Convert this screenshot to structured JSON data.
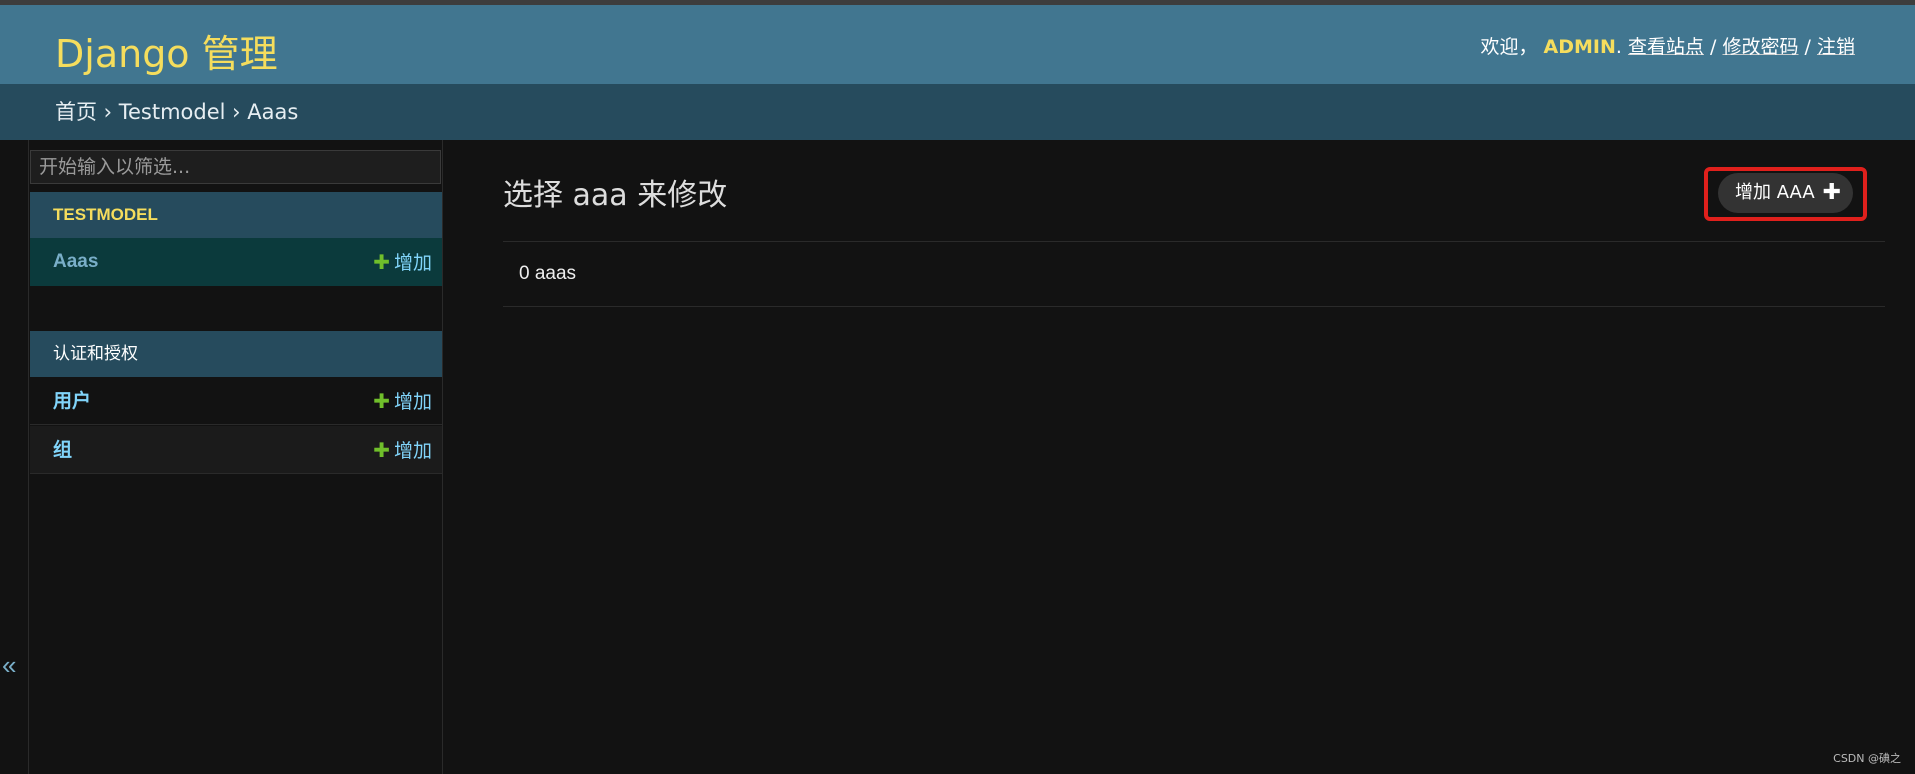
{
  "header": {
    "brand": "Django 管理",
    "welcome": "欢迎，",
    "username": "ADMIN",
    "view_site": "查看站点",
    "change_password": "修改密码",
    "logout": "注销",
    "separator": " / "
  },
  "breadcrumbs": {
    "home": "首页",
    "app": "Testmodel",
    "model": "Aaas",
    "separator": " › "
  },
  "sidebar": {
    "filter_placeholder": "开始输入以筛选...",
    "toggle_icon": "«",
    "modules": [
      {
        "caption": "TESTMODEL",
        "models": [
          {
            "name": "Aaas",
            "add_label": "增加"
          }
        ]
      },
      {
        "caption": "认证和授权",
        "models": [
          {
            "name": "用户",
            "add_label": "增加"
          },
          {
            "name": "组",
            "add_label": "增加"
          }
        ]
      }
    ]
  },
  "content": {
    "title": "选择 aaa 来修改",
    "add_button": "增加 AAA",
    "result_count": "0 aaas"
  },
  "watermark": "CSDN @碘之",
  "colors": {
    "header_bg": "#417690",
    "brand": "#f5dd5d",
    "breadcrumb_bg": "#264b5d",
    "link": "#81d4fa",
    "add_plus": "#70bf2b",
    "highlight": "#e0201c"
  }
}
